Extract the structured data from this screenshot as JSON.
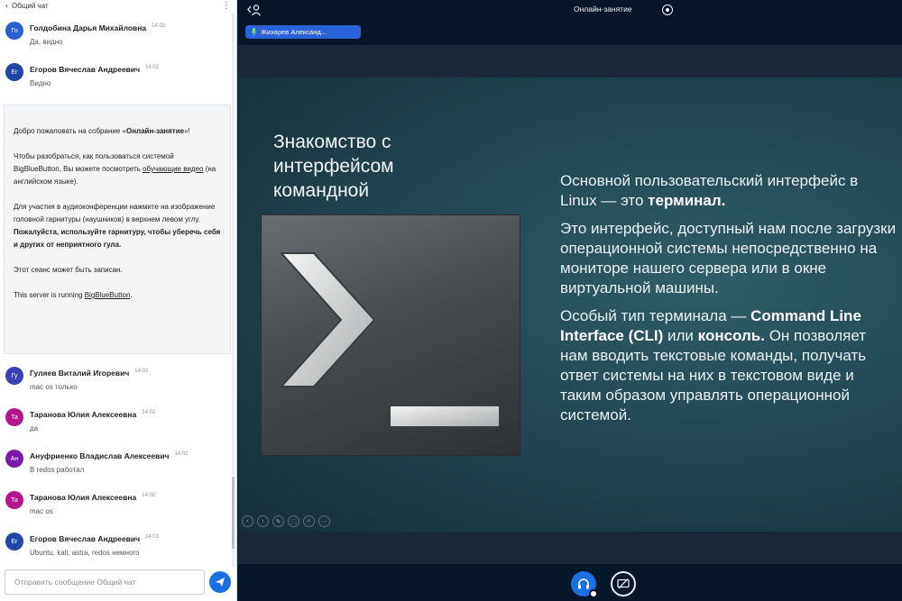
{
  "chat": {
    "header_back": "‹",
    "header_title": "Общий чат",
    "header_menu": "⋮",
    "messages_top": [
      {
        "avatar": "Го",
        "color": "#2a5fd0",
        "name": "Голдобина Дарья Михайловна",
        "time": "14:02",
        "text": "Да, видно"
      },
      {
        "avatar": "Ег",
        "color": "#2047a8",
        "name": "Егоров Вячеслав Андреевич",
        "time": "14:02",
        "text": "Видно"
      }
    ],
    "welcome": {
      "line1_pre": "Добро пожаловать на собрание «",
      "line1_bold": "Онлайн-занятие",
      "line1_post": "»!",
      "line2_pre": "Чтобы разобраться, как пользоваться системой BigBlueButton, Вы можете посмотреть ",
      "line2_link": "обучающие видео",
      "line2_post": " (на английском языке).",
      "line3": "Для участия в аудиоконференции нажмите на изображение головной гарнитуры (наушников) в верхнем левом углу. ",
      "line3_bold": "Пожалуйста, используйте гарнитуру, чтобы уберечь себя и других от неприятного гула.",
      "line4": "Этот сеанс может быть записан.",
      "line5_pre": "This server is running ",
      "line5_link": "BigBlueButton",
      "line5_post": "."
    },
    "messages_bottom": [
      {
        "avatar": "Гу",
        "color": "#3a3fb5",
        "name": "Гуляев Виталий Игоревич",
        "time": "14:02",
        "text": "mac os только"
      },
      {
        "avatar": "Та",
        "color": "#b5158c",
        "name": "Таранова Юлия Алексеевна",
        "time": "14:02",
        "text": "да"
      },
      {
        "avatar": "Ан",
        "color": "#7a1aa8",
        "name": "Ануфриенко Владислав Алексеевич",
        "time": "14:02",
        "text": "В redos работал"
      },
      {
        "avatar": "Та",
        "color": "#b5158c",
        "name": "Таранова Юлия Алексеевна",
        "time": "14:02",
        "text": "mac os"
      },
      {
        "avatar": "Ег",
        "color": "#2047a8",
        "name": "Егоров Вячеслав Андреевич",
        "time": "14:03",
        "text": "Ubuntu, kali, astra, redos немного"
      }
    ],
    "input_placeholder": "Отправить сообщение Общий чат"
  },
  "main": {
    "session_title": "Онлайн-занятие",
    "talker_name": "Жихарев Александ..."
  },
  "slide": {
    "title": "Знакомство с интерфейсом командной",
    "p1_pre": "Основной пользовательский интерфейс в Linux — это ",
    "p1_bold": "терминал.",
    "p2": "Это интерфейс, доступный нам после загрузки операционной системы непосредственно на мониторе нашего сервера или в окне виртуальной машины.",
    "p3_pre": "Особый тип терминала — ",
    "p3_bold1": "Command Line Interface (CLI)",
    "p3_mid": " или ",
    "p3_bold2": "консоль.",
    "p3_post": " Он позволяет нам вводить текстовые команды, получать ответ системы на них в текстовом виде и таким образом управлять операционной системой."
  },
  "icons": {
    "user_list": "users-icon",
    "record": "record-icon",
    "mic": "microphone-icon",
    "send": "send-icon",
    "audio": "headset-icon",
    "share": "screen-share-off-icon",
    "terminal": "terminal-prompt-icon"
  }
}
